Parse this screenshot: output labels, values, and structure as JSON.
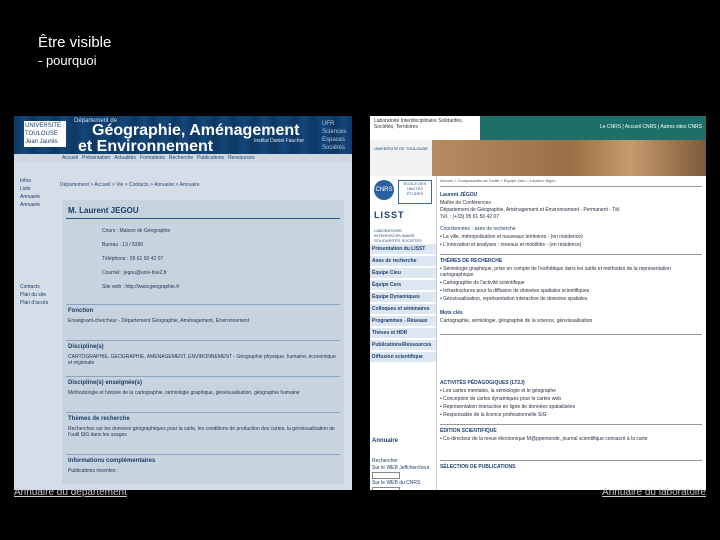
{
  "slide": {
    "title": "Être visible",
    "subtitle": "- pourquoi",
    "caption_left": "Annuaire du département",
    "caption_right": "Annuaire du laboratoire"
  },
  "left_screenshot": {
    "university_logo": "UNIVERSITÉ TOULOUSE Jean Jaurès",
    "department_label": "Département de",
    "heading_line1": "Géographie, Aménagement",
    "heading_line2": "et Environnement",
    "institute": "Institut Daniel Faucher",
    "side_links": [
      "UFR",
      "Sciences",
      "Espaces",
      "Sociétés"
    ],
    "nav": [
      "Accueil",
      "Présentation",
      "Actualités",
      "Formations",
      "Recherche",
      "Publications",
      "Ressources"
    ],
    "sidebar_items": [
      "Infos",
      "Liste",
      "Annuaire",
      "Annuaire"
    ],
    "sidebar_items_2": [
      "Contacts",
      "Plan du site",
      "Plan d'accès"
    ],
    "breadcrumb": "Département > Accueil > Vie > Contacts > Annuaire > Annuaire",
    "person_name": "M. Laurent JEGOU",
    "fields": [
      "Cours : Maison de Géographie",
      "Bureau : 13 / 5390",
      "Téléphone : 05 61 50 42 07",
      "Courriel : jegou@univ-tlse2.fr",
      "Site web : http://www.geographie.fr"
    ],
    "section_fonction": "Fonction",
    "fonction_text": "Enseignant-chercheur - Département Géographie, Aménagement, Environnement",
    "section_disciplines": "Discipline(s)",
    "disciplines_text": "CARTOGRAPHIE, GEOGRAPHIE, AMENAGEMENT, ENVIRONNEMENT - Géographie physique, humaine, économique et régionale",
    "section_themes": "Discipline(s) enseignée(s)",
    "themes_text": "Méthodologie et histoire de la cartographie, sémiologie graphique, géovisualisation, géographie humaine",
    "section_recherche": "Thèmes de recherche",
    "recherche_text": "Recherches sur les données géographiques pour la carte, les conditions de production des cartes, la géovisualisation de l'outil SIG dans les usages",
    "section_info": "Informations complémentaires",
    "info_text": "Publications récentes :"
  },
  "right_screenshot": {
    "top_text": "Laboratoire Interdisciplinaire Solidarités, Sociétés, Territoires",
    "top_links": "Le CNRS | Accueil CNRS | Autres sites CNRS",
    "logo_text": "UNIVERSITÉ DE TOULOUSE",
    "cnrs": "CNRS",
    "ecole": "ÉCOLE DES HAUTES ÉTUDES",
    "lisst": "LISST",
    "lisst_sub": "LABORATOIRE INTERDISCIPLINAIRE SOLIDARITÉS SOCIÉTÉS TERRITOIRES",
    "menu": [
      "Présentation du LISST",
      "Axes de recherche",
      "Équipe Cieu",
      "Équipe Cers",
      "Équipe Dynamiques",
      "Colloques et séminaires",
      "Programmes - Réseaux",
      "Thèses et HDR",
      "Publications/Ressources",
      "Diffusion scientifique"
    ],
    "annuaire": "Annuaire",
    "recherche_label": "Rechercher",
    "recherche_item1": "Sur le WEB Jeffchercheur",
    "recherche_item2": "Sur le WEB du CNRS",
    "breadcrumb": "Accueil > Composantes de l'unité > Équipe Cieu > Laurent Jégou",
    "name": "Laurent JÉGOU",
    "lines": [
      "Maître de Conférences",
      "Département de Géographie, Aménagement et Environnement - Permanent - Tél.",
      "Tél. : (+33) 05 61 50 42 07"
    ],
    "contacts_head": "Coordonnées - axes de recherche",
    "contacts": [
      "• La ville, métropolisation et nouveaux territoires - (en résidence)",
      "• L'innovation et analyses : réseaux et mobilités - (en résidence)"
    ],
    "themes_head": "THÈMES DE RECHERCHE",
    "themes": [
      "• Sémiologie graphique, prise en compte de l'esthétique dans les outils et méthodes de la représentation cartographique",
      "• Cartographie de l'activité scientifique",
      "• Infrastructures pour la diffusion de données spatiales scientifiques",
      "• Géovisualisation, représentation interactive de données spatiales"
    ],
    "keywords_head": "Mots clés",
    "keywords": "Cartographie, sémiologie, géographie de la science, géovisualisation",
    "activites_head": "ACTIVITÉS PÉDAGOGIQUES (LT2J)",
    "activites": [
      "• Les cartes mentales, la sémiologie et le géographe",
      "• Conception de cartes dynamiques pour le cartes web",
      "• Représentation interactive en ligne de données spatialisées",
      "• Responsable de la licence professionnelle SIG"
    ],
    "edition_head": "ÉDITION SCIENTIFIQUE",
    "edition": "• Co-directeur de la revue électronique M@ppemonde, journal scientifique consacré à la carte",
    "selection_head": "SÉLECTION DE PUBLICATIONS"
  }
}
